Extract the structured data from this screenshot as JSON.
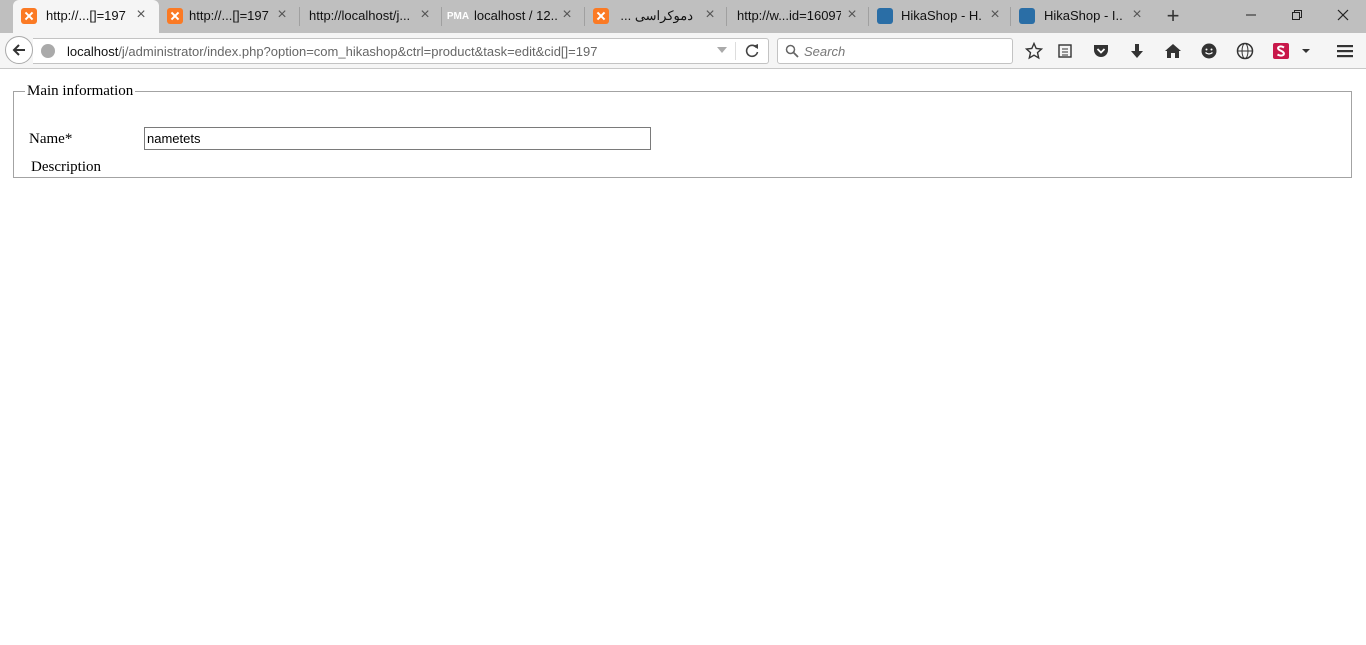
{
  "browser": {
    "tabs": [
      {
        "title": "http://...[]=197",
        "favicon": "xampp-icon",
        "active": true
      },
      {
        "title": "http://...[]=197",
        "favicon": "xampp-icon",
        "active": false
      },
      {
        "title": "http://localhost/j...",
        "favicon": "",
        "active": false
      },
      {
        "title": "localhost / 12...",
        "favicon": "phpmyadmin-icon",
        "active": false
      },
      {
        "title": "دموکراسی ...",
        "favicon": "xampp-icon",
        "active": false
      },
      {
        "title": "http://w...id=16097",
        "favicon": "",
        "active": false
      },
      {
        "title": "HikaShop - H...",
        "favicon": "hikashop-icon",
        "active": false
      },
      {
        "title": "HikaShop - I...",
        "favicon": "hikashop-icon",
        "active": false
      }
    ],
    "pma_label": "PMA",
    "url_host": "localhost",
    "url_path": "/j/administrator/index.php?option=com_hikashop&ctrl=product&task=edit&cid[]=197",
    "search_placeholder": "Search"
  },
  "form": {
    "legend": "Main information",
    "name_label": "Name*",
    "name_value": "nametets",
    "description_label": "Description"
  },
  "colors": {
    "tabbar_bg": "#bfbfbf",
    "active_tab_bg": "#f5f5f5",
    "xampp_orange": "#fb7a24",
    "hikashop_blue": "#2a6ea6"
  }
}
